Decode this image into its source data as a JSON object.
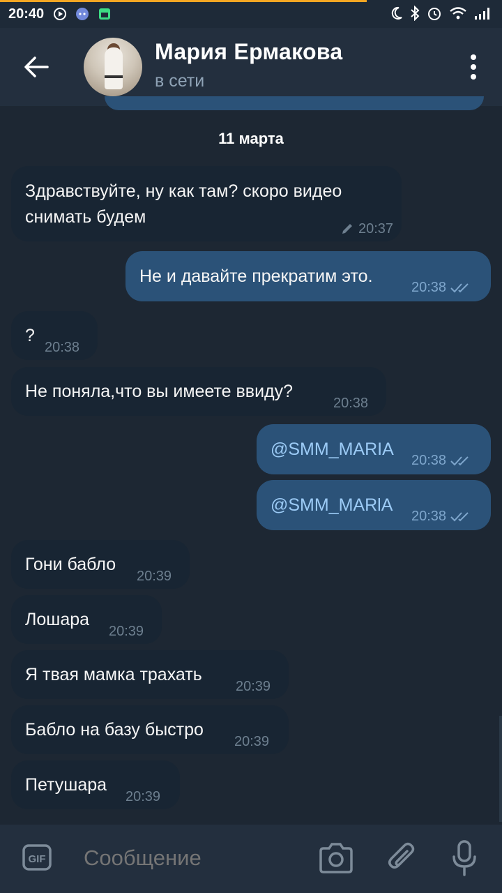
{
  "status_bar": {
    "time": "20:40"
  },
  "header": {
    "name": "Мария Ермакова",
    "status": "в сети"
  },
  "date_label": "11 марта",
  "messages": [
    {
      "dir": "in",
      "lines": [
        "Здравствуйте, ну как там? скоро видео",
        "снимать будем"
      ],
      "time": "20:37",
      "edited": true
    },
    {
      "dir": "out",
      "text": "Не и давайте прекратим это.",
      "time": "20:38"
    },
    {
      "dir": "in",
      "text": "?",
      "time": "20:38"
    },
    {
      "dir": "in",
      "text": "Не поняла,что вы имеете ввиду?",
      "time": "20:38"
    },
    {
      "dir": "out",
      "text": "@SMM_MARIA",
      "time": "20:38"
    },
    {
      "dir": "out",
      "text": "@SMM_MARlA",
      "time": "20:38"
    },
    {
      "dir": "in",
      "text": "Гони бабло",
      "time": "20:39"
    },
    {
      "dir": "in",
      "text": "Лошара",
      "time": "20:39"
    },
    {
      "dir": "in",
      "text": "Я твая мамка трахать",
      "time": "20:39"
    },
    {
      "dir": "in",
      "text": "Бабло на базу быстро",
      "time": "20:39"
    },
    {
      "dir": "in",
      "text": "Петушара",
      "time": "20:39"
    }
  ],
  "composer": {
    "placeholder": "Сообщение"
  },
  "colors": {
    "background": "#1d2733",
    "header": "#232f3e",
    "incoming_bubble": "#182533",
    "outgoing_bubble": "#2b5278",
    "mention": "#9ccbf6"
  },
  "icons": [
    "back-arrow-icon",
    "more-vertical-icon",
    "gif-icon",
    "camera-icon",
    "paperclip-icon",
    "microphone-icon",
    "pencil-icon",
    "double-check-icon"
  ]
}
